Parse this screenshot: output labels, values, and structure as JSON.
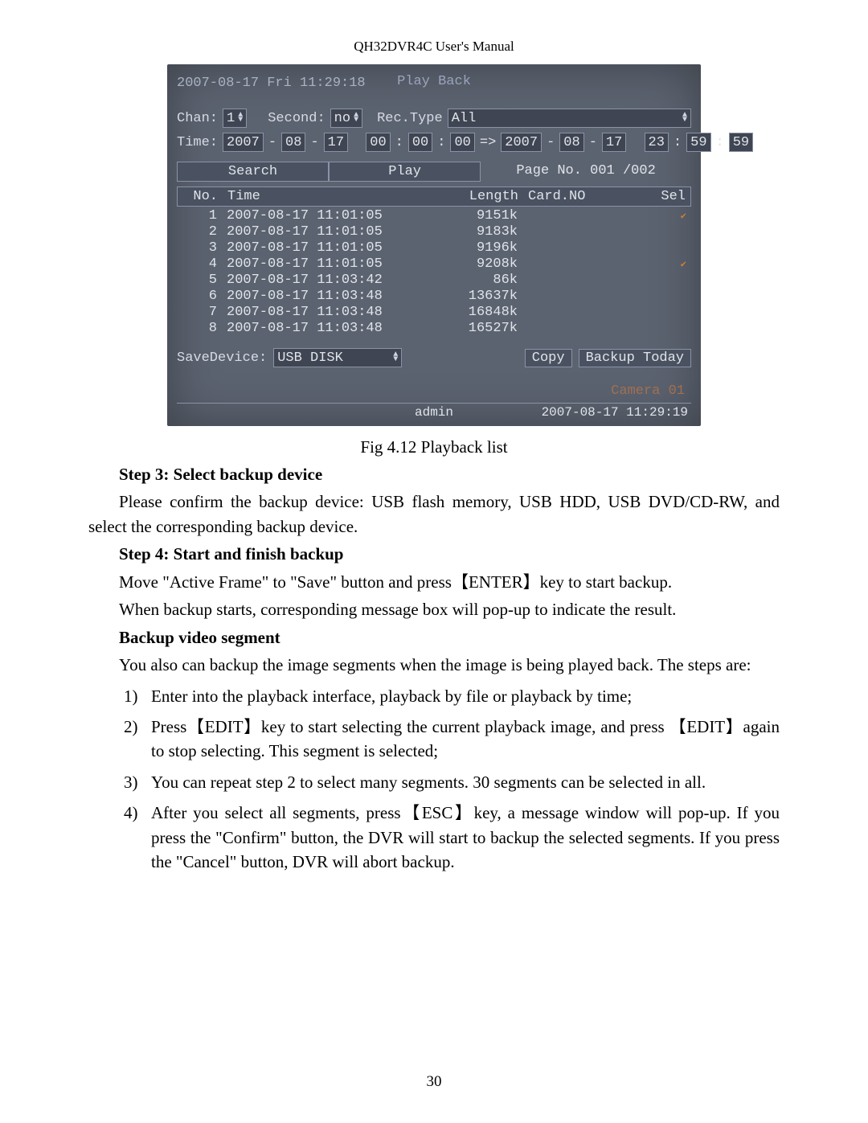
{
  "header": "QH32DVR4C User's Manual",
  "page_number": "30",
  "dvr": {
    "clock_overlay": "2007-08-17 Fri 11:29:18",
    "title": "Play Back",
    "chan_label": "Chan:",
    "chan_value": "1",
    "second_label": "Second:",
    "second_value": "no",
    "rectype_label": "Rec.Type",
    "rectype_value": "All",
    "time_label": "Time:",
    "time_from": {
      "y": "2007",
      "mo": "08",
      "d": "17",
      "h": "00",
      "mi": "00",
      "s": "00"
    },
    "time_arrow": "=>",
    "time_to": {
      "y": "2007",
      "mo": "08",
      "d": "17",
      "h": "23",
      "mi": "59",
      "s": "59"
    },
    "btn_search": "Search",
    "btn_play": "Play",
    "page_text": "Page No. 001 /002",
    "cols": {
      "no": "No.",
      "time": "Time",
      "length": "Length",
      "card": "Card.NO",
      "sel": "Sel"
    },
    "rows": [
      {
        "no": "1",
        "time": "2007-08-17 11:01:05",
        "len": "9151k",
        "card": "",
        "sel": true
      },
      {
        "no": "2",
        "time": "2007-08-17 11:01:05",
        "len": "9183k",
        "card": "",
        "sel": false
      },
      {
        "no": "3",
        "time": "2007-08-17 11:01:05",
        "len": "9196k",
        "card": "",
        "sel": false
      },
      {
        "no": "4",
        "time": "2007-08-17 11:01:05",
        "len": "9208k",
        "card": "",
        "sel": true
      },
      {
        "no": "5",
        "time": "2007-08-17 11:03:42",
        "len": "86k",
        "card": "",
        "sel": false
      },
      {
        "no": "6",
        "time": "2007-08-17 11:03:48",
        "len": "13637k",
        "card": "",
        "sel": false
      },
      {
        "no": "7",
        "time": "2007-08-17 11:03:48",
        "len": "16848k",
        "card": "",
        "sel": false
      },
      {
        "no": "8",
        "time": "2007-08-17 11:03:48",
        "len": "16527k",
        "card": "",
        "sel": false
      }
    ],
    "save_label": "SaveDevice:",
    "save_value": "USB DISK",
    "btn_copy": "Copy",
    "btn_backup": "Backup Today",
    "camera_label": "Camera  01",
    "footer_user": "admin",
    "footer_ts": "2007-08-17 11:29:19"
  },
  "caption": "Fig 4.12 Playback list",
  "doc": {
    "step3_title": "Step 3: Select backup device",
    "step3_text": "Please confirm the backup device: USB flash memory, USB HDD, USB DVD/CD-RW, and select the corresponding backup device.",
    "step4_title": "Step 4: Start and finish backup",
    "step4_p1": "Move \"Active Frame\" to \"Save\" button and press【ENTER】key to start backup.",
    "step4_p2": "When backup starts, corresponding message box will pop-up to indicate the result.",
    "bvs_title": "Backup video segment",
    "bvs_intro": "You also can backup the image segments when the image is being played back. The steps are:",
    "items": [
      "Enter into the playback interface, playback by file or playback by time;",
      "Press【EDIT】key to start selecting the current playback image, and press 【EDIT】again to stop selecting. This segment is selected;",
      "You can repeat step 2 to select many segments. 30 segments can be selected in all.",
      "After you select all segments, press【ESC】key, a message window will pop-up. If you press the \"Confirm\" button, the DVR will start to backup the selected segments. If you press the \"Cancel\" button, DVR will abort backup."
    ],
    "nums": [
      "1)",
      "2)",
      "3)",
      "4)"
    ]
  }
}
